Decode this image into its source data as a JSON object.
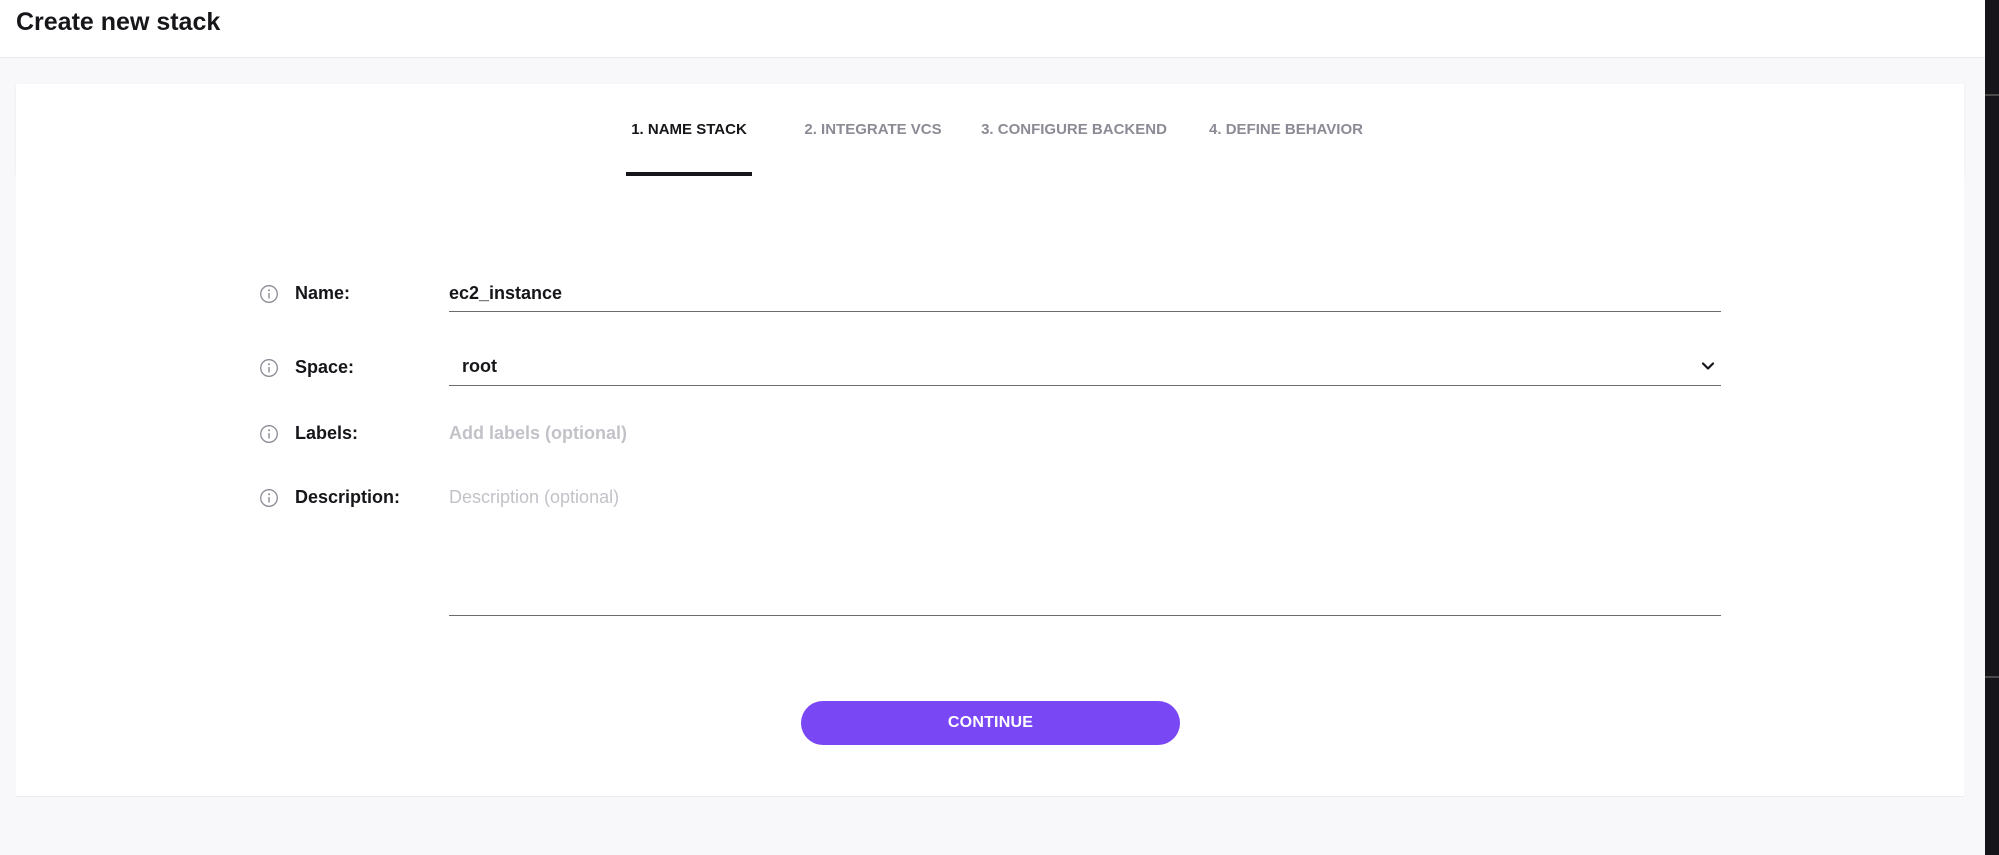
{
  "page": {
    "title": "Create new stack"
  },
  "steps": [
    {
      "label": "1. NAME STACK",
      "active": true
    },
    {
      "label": "2. INTEGRATE VCS",
      "active": false
    },
    {
      "label": "3. CONFIGURE BACKEND",
      "active": false
    },
    {
      "label": "4. DEFINE BEHAVIOR",
      "active": false
    }
  ],
  "form": {
    "name": {
      "label": "Name:",
      "value": "ec2_instance"
    },
    "space": {
      "label": "Space:",
      "value": "root"
    },
    "labels": {
      "label": "Labels:",
      "placeholder": "Add labels (optional)"
    },
    "description": {
      "label": "Description:",
      "placeholder": "Description (optional)"
    }
  },
  "actions": {
    "continue_label": "CONTINUE"
  },
  "icons": {
    "info": "info-icon",
    "dropdown": "chevron-down-icon"
  },
  "colors": {
    "accent": "#7a47f5",
    "text": "#16161a",
    "muted": "#8b8b95",
    "placeholder": "#c2c2c8"
  }
}
